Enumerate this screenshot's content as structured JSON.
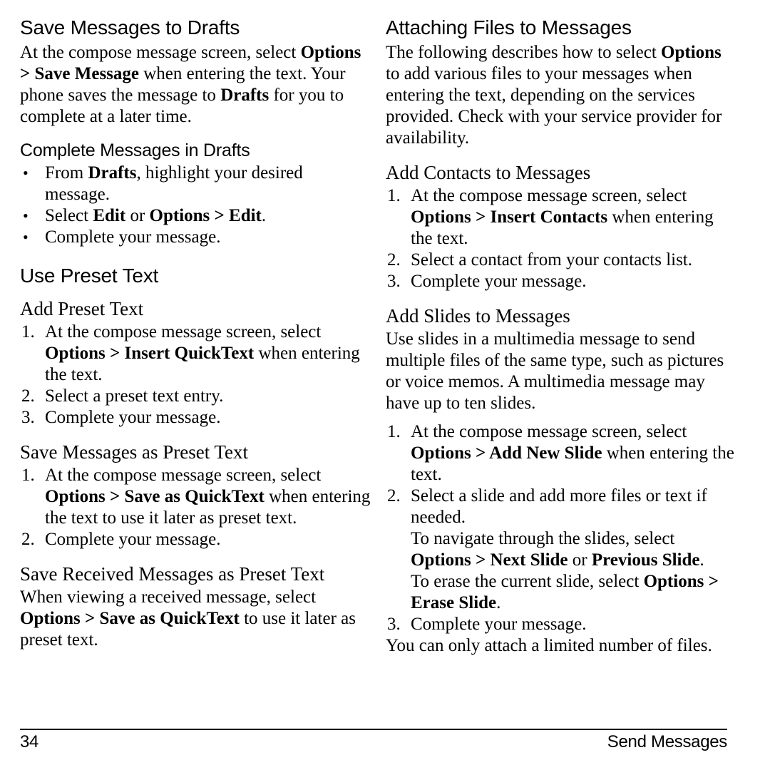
{
  "page": {
    "number": "34",
    "section": "Send Messages"
  },
  "left_column": {
    "s1": {
      "heading": "Save Messages to Drafts",
      "para_a": "At the compose message screen, select ",
      "para_b": "Options > Save Message",
      "para_c": " when entering the text. Your phone saves the message to ",
      "para_d": "Drafts",
      "para_e": " for you to complete at a later time."
    },
    "s2": {
      "heading": "Complete Messages in Drafts",
      "b1_a": "From ",
      "b1_b": "Drafts",
      "b1_c": ", highlight your desired message.",
      "b2_a": "Select ",
      "b2_b": "Edit",
      "b2_c": " or ",
      "b2_d": "Options > Edit",
      "b2_e": ".",
      "b3": "Complete your message.",
      "bullet_marker": "•"
    },
    "s3": {
      "heading": "Use Preset Text"
    },
    "s4": {
      "heading": "Add Preset Text",
      "n1_marker": "1.",
      "n1_a": "At the compose message screen, select ",
      "n1_b": "Options > Insert QuickText",
      "n1_c": " when entering the text.",
      "n2_marker": "2.",
      "n2": "Select a preset text entry.",
      "n3_marker": "3.",
      "n3": "Complete your message."
    },
    "s5": {
      "heading": "Save Messages as Preset Text",
      "n1_marker": "1.",
      "n1_a": "At the compose message screen, select ",
      "n1_b": "Options > Save as QuickText",
      "n1_c": " when entering the text to use it later as preset text.",
      "n2_marker": "2.",
      "n2": "Complete your message."
    },
    "s6": {
      "heading": "Save Received Messages as Preset Text",
      "para_a": "When viewing a received message, select ",
      "para_b": "Options > Save as QuickText",
      "para_c": " to use it later as preset text."
    }
  },
  "right_column": {
    "s1": {
      "heading": "Attaching Files to Messages",
      "para_a": "The following describes how to select ",
      "para_b": "Options",
      "para_c": " to add various files to your messages when entering the text, depending on the services provided. Check with your service provider for availability."
    },
    "s2": {
      "heading": "Add Contacts to Messages",
      "n1_marker": "1.",
      "n1_a": "At the compose message screen, select ",
      "n1_b": "Options > Insert Contacts",
      "n1_c": " when entering the text.",
      "n2_marker": "2.",
      "n2": "Select a contact from your contacts list.",
      "n3_marker": "3.",
      "n3": "Complete your message."
    },
    "s3": {
      "heading": "Add Slides to Messages",
      "para": "Use slides in a multimedia message to send multiple files of the same type, such as pictures or voice memos. A multimedia message may have up to ten slides.",
      "n1_marker": "1.",
      "n1_a": "At the compose message screen, select ",
      "n1_b": "Options > Add New Slide",
      "n1_c": " when entering the text.",
      "n2_marker": "2.",
      "n2_a": "Select a slide and add more files or text if needed.",
      "n2_b": "To navigate through the slides, select ",
      "n2_c": "Options > Next Slide",
      "n2_d": " or ",
      "n2_e": "Previous Slide",
      "n2_f": ".",
      "n2_g": "To erase the current slide, select ",
      "n2_h": "Options > ",
      "n2_i": "Erase Slide",
      "n2_j": ".",
      "n3_marker": "3.",
      "n3": "Complete your message.",
      "closing": "You can only attach a limited number of files."
    }
  }
}
